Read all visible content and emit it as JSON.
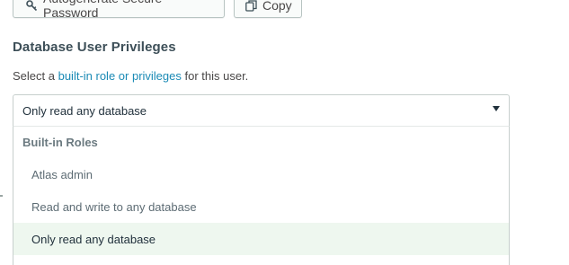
{
  "actions": {
    "generate_label": "Autogenerate Secure Password",
    "copy_label": "Copy"
  },
  "privileges": {
    "title": "Database User Privileges",
    "help_prefix": "Select a ",
    "help_link": "built-in role or privileges",
    "help_suffix": " for this user.",
    "selected_value": "Only read any database",
    "group_label": "Built-in Roles",
    "options": [
      "Atlas admin",
      "Read and write to any database",
      "Only read any database"
    ],
    "selected_index": 2
  },
  "icons": {
    "generate": "key-icon",
    "copy": "copy-icon",
    "select": "chevron-down-icon"
  },
  "colors": {
    "link": "#1a8ab5",
    "selected_background": "#eef7ef",
    "title": "#3d4f58"
  }
}
